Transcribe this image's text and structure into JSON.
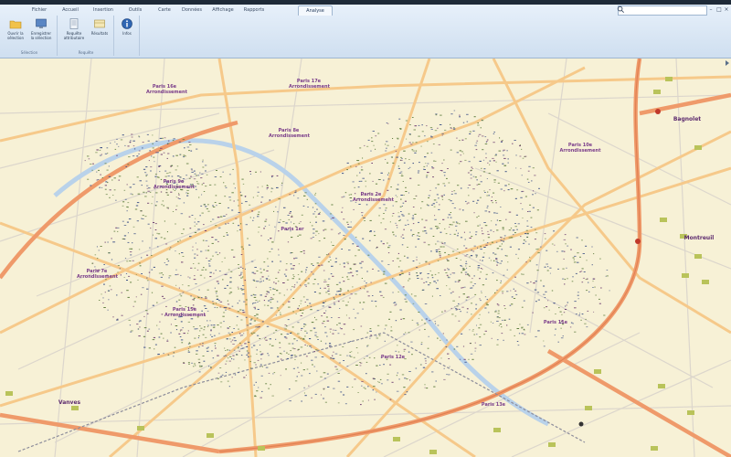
{
  "window": {
    "search_placeholder": ""
  },
  "ribbon": {
    "tabs": [
      {
        "label": "Fichier",
        "active": false
      },
      {
        "label": "Accueil",
        "active": false
      },
      {
        "label": "Insertion",
        "active": false
      },
      {
        "label": "Outils",
        "active": false
      },
      {
        "label": "Carte",
        "active": false
      },
      {
        "label": "Données",
        "active": false
      },
      {
        "label": "Affichage",
        "active": false
      },
      {
        "label": "Rapports",
        "active": false
      },
      {
        "label": "Analyse",
        "active": true
      }
    ],
    "groups": [
      {
        "label": "Sélection",
        "buttons": [
          {
            "label": "Ouvrir la sélection",
            "icon": "folder-icon"
          },
          {
            "label": "Enregistrer la sélection",
            "icon": "monitor-icon"
          }
        ]
      },
      {
        "label": "Requête",
        "buttons": [
          {
            "label": "Requête attributaire",
            "icon": "document-icon"
          },
          {
            "label": "Résultats",
            "icon": "table-icon"
          }
        ]
      },
      {
        "label": "",
        "buttons": [
          {
            "label": "Infos",
            "icon": "info-icon"
          }
        ]
      }
    ]
  },
  "map": {
    "labels": [
      {
        "text": "Paris 16e Arrondissement",
        "big": false
      },
      {
        "text": "Paris 17e Arrondissement",
        "big": false
      },
      {
        "text": "Paris 8e Arrondissement",
        "big": false
      },
      {
        "text": "Paris 9e Arrondissement",
        "big": false
      },
      {
        "text": "Paris 10e Arrondissement",
        "big": false
      },
      {
        "text": "Paris 2e Arrondissement",
        "big": false
      },
      {
        "text": "Paris 1er",
        "big": false
      },
      {
        "text": "Paris 7e Arrondissement",
        "big": false
      },
      {
        "text": "Paris 15e Arrondissement",
        "big": false
      },
      {
        "text": "Paris 11e",
        "big": false
      },
      {
        "text": "Paris 12e",
        "big": false
      },
      {
        "text": "Paris 13e",
        "big": false
      },
      {
        "text": "Bagnolet",
        "big": true
      },
      {
        "text": "Montreuil",
        "big": true
      },
      {
        "text": "Vanves",
        "big": true
      }
    ]
  },
  "colors": {
    "map_bg": "#f7f1d6",
    "highway": "#f0a06a",
    "major_road": "#f6c98a",
    "minor_road": "#d9d6d2",
    "river": "#b9d2ea",
    "dots_green": "#5a7a3a",
    "dots_blue": "#3b4f86",
    "dots_purple": "#6b3a6e",
    "label": "#7a3d8a"
  }
}
